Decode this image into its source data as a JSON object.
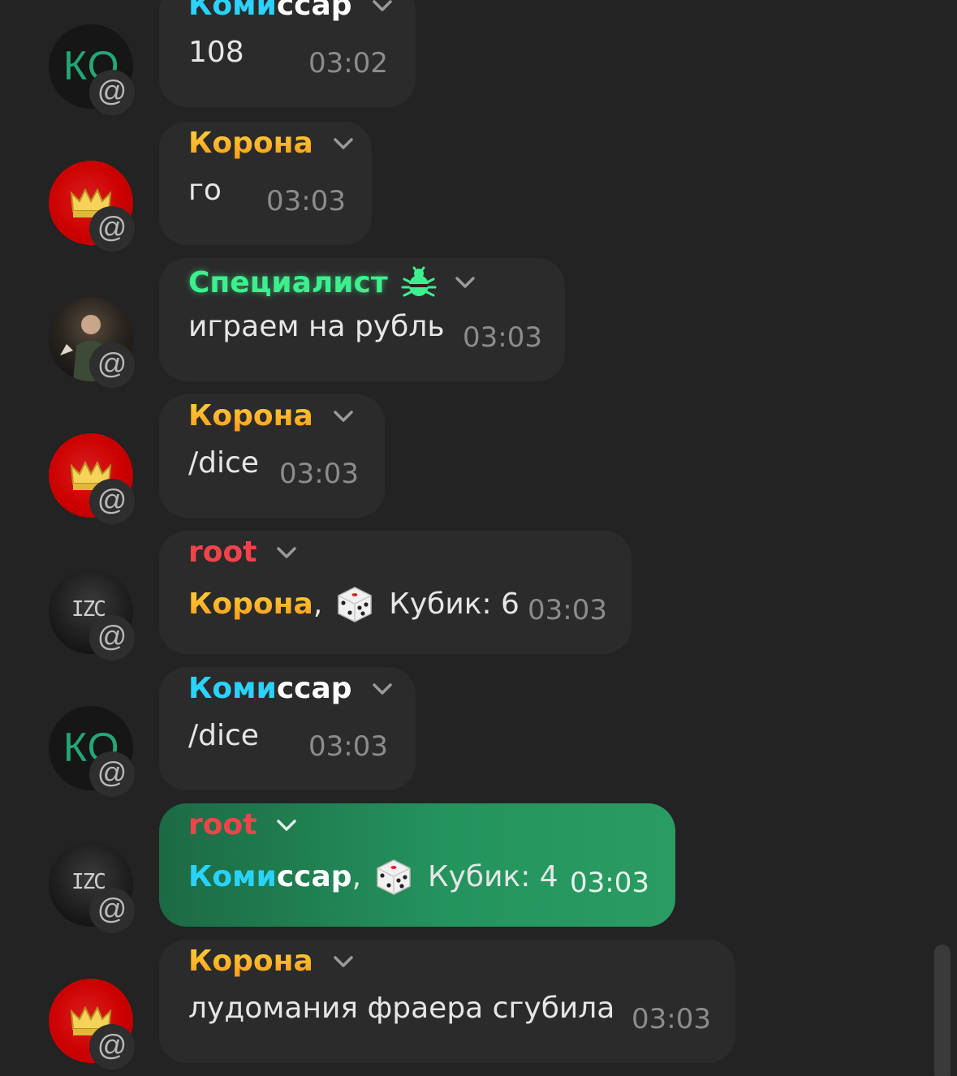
{
  "messages": [
    {
      "sender_a": "Коми",
      "sender_b": "ссар",
      "text": "108",
      "time": "03:02"
    },
    {
      "sender": "Корона",
      "text": "го",
      "time": "03:03"
    },
    {
      "sender": "Специалист",
      "text": "играем на рубль",
      "time": "03:03"
    },
    {
      "sender": "Корона",
      "text": "/dice",
      "time": "03:03"
    },
    {
      "sender": "root",
      "mention": "Корона",
      "comma": ",",
      "dice_text": "Кубик: 6",
      "time": "03:03"
    },
    {
      "sender_a": "Коми",
      "sender_b": "ссар",
      "text": "/dice",
      "time": "03:03"
    },
    {
      "sender": "root",
      "mention_a": "Коми",
      "mention_b": "ссар",
      "comma": ",",
      "dice_text": "Кубик: 4",
      "time": "03:03"
    },
    {
      "sender": "Корона",
      "text": "лудомания фраера сгубила",
      "time": "03:03"
    }
  ],
  "avatar": {
    "ko_label": "КО",
    "root_label": "IZC",
    "mention_symbol": "@"
  },
  "colors": {
    "background": "#232323",
    "bubble": "#2b2b2b",
    "own_bubble": "#24935d",
    "komissar": "#2ad3ff",
    "korona": "#ffb22a",
    "specialist": "#3df08e",
    "root": "#f2434b"
  },
  "icons": [
    "chevron-down-icon",
    "dice-icon",
    "bug-badge-icon",
    "crown-icon",
    "mention-icon"
  ]
}
